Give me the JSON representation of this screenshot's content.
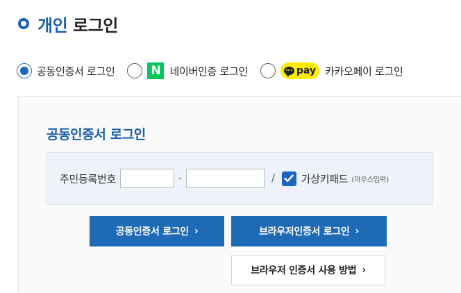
{
  "header": {
    "title_highlight": "개인",
    "title_rest": "로그인"
  },
  "methods": [
    {
      "label": "공동인증서 로그인",
      "selected": true
    },
    {
      "label": "네이버인증 로그인",
      "selected": false,
      "badge": "N"
    },
    {
      "label": "카카오페이 로그인",
      "selected": false,
      "badge": "pay"
    }
  ],
  "panel": {
    "title": "공동인증서 로그인",
    "rrn_label": "주민등록번호",
    "rrn_front_value": "",
    "rrn_back_value": "",
    "dash": "-",
    "slash": "/",
    "virtual_keypad_checked": true,
    "virtual_keypad_label": "가상키패드",
    "virtual_keypad_sub": "(마우스입력)"
  },
  "buttons": {
    "cert_login": "공동인증서 로그인",
    "browser_cert_login": "브라우저인증서 로그인",
    "browser_cert_howto": "브라우저 인증서 사용 방법",
    "chevron": "›"
  },
  "colors": {
    "accent": "#1a5fb4",
    "button": "#1e6ab6",
    "naver": "#03c75a",
    "kakao": "#ffeb00"
  }
}
